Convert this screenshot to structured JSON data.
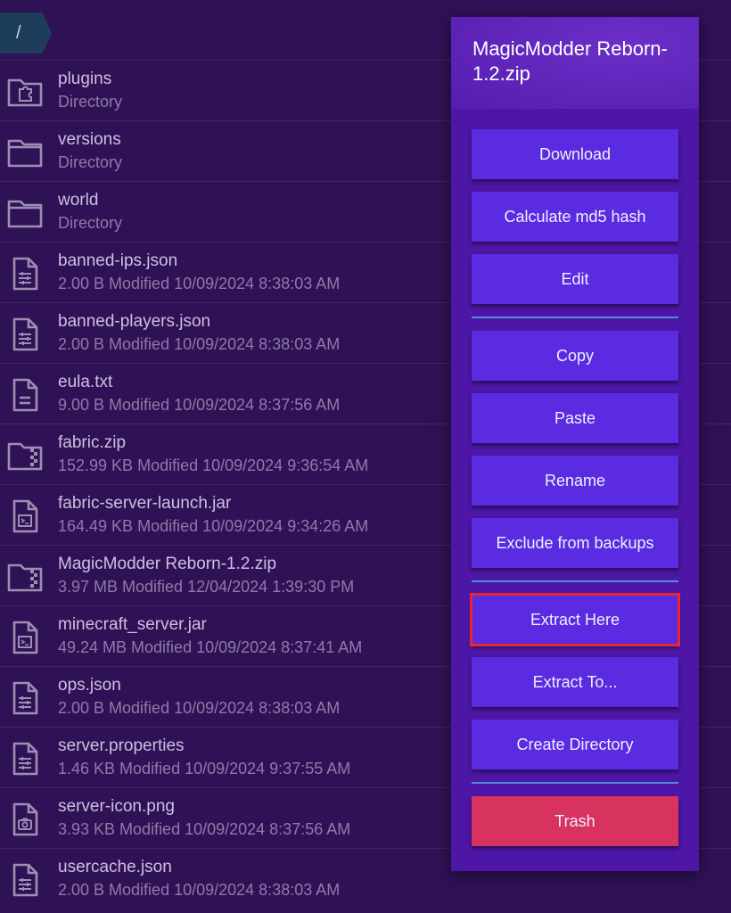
{
  "breadcrumb": {
    "path": "/"
  },
  "files": [
    {
      "name": "plugins",
      "meta": "Directory",
      "icon": "puzzle-folder-icon"
    },
    {
      "name": "versions",
      "meta": "Directory",
      "icon": "folder-icon"
    },
    {
      "name": "world",
      "meta": "Directory",
      "icon": "folder-icon"
    },
    {
      "name": "banned-ips.json",
      "meta": "2.00 B Modified 10/09/2024 8:38:03 AM",
      "icon": "settings-file-icon"
    },
    {
      "name": "banned-players.json",
      "meta": "2.00 B Modified 10/09/2024 8:38:03 AM",
      "icon": "settings-file-icon"
    },
    {
      "name": "eula.txt",
      "meta": "9.00 B Modified 10/09/2024 8:37:56 AM",
      "icon": "text-file-icon"
    },
    {
      "name": "fabric.zip",
      "meta": "152.99 KB Modified 10/09/2024 9:36:54 AM",
      "icon": "zip-folder-icon"
    },
    {
      "name": "fabric-server-launch.jar",
      "meta": "164.49 KB Modified 10/09/2024 9:34:26 AM",
      "icon": "terminal-file-icon"
    },
    {
      "name": "MagicModder Reborn-1.2.zip",
      "meta": "3.97 MB Modified 12/04/2024 1:39:30 PM",
      "icon": "zip-folder-icon"
    },
    {
      "name": "minecraft_server.jar",
      "meta": "49.24 MB Modified 10/09/2024 8:37:41 AM",
      "icon": "terminal-file-icon"
    },
    {
      "name": "ops.json",
      "meta": "2.00 B Modified 10/09/2024 8:38:03 AM",
      "icon": "settings-file-icon"
    },
    {
      "name": "server.properties",
      "meta": "1.46 KB Modified 10/09/2024 9:37:55 AM",
      "icon": "settings-file-icon"
    },
    {
      "name": "server-icon.png",
      "meta": "3.93 KB Modified 10/09/2024 8:37:56 AM",
      "icon": "image-file-icon"
    },
    {
      "name": "usercache.json",
      "meta": "2.00 B Modified 10/09/2024 8:38:03 AM",
      "icon": "settings-file-icon"
    }
  ],
  "menu": {
    "title": "MagicModder Reborn-1.2.zip",
    "groups": [
      [
        "Download",
        "Calculate md5 hash",
        "Edit"
      ],
      [
        "Copy",
        "Paste",
        "Rename",
        "Exclude from backups"
      ],
      [
        "Extract Here",
        "Extract To...",
        "Create Directory"
      ],
      [
        "Trash"
      ]
    ],
    "highlighted": "Extract Here"
  },
  "colors": {
    "background": "#2f1256",
    "menu": "#4d16a6",
    "button": "#5a2be0",
    "danger": "#d8325f",
    "highlight_outline": "#e8262f",
    "divider": "#4fa6e0"
  }
}
